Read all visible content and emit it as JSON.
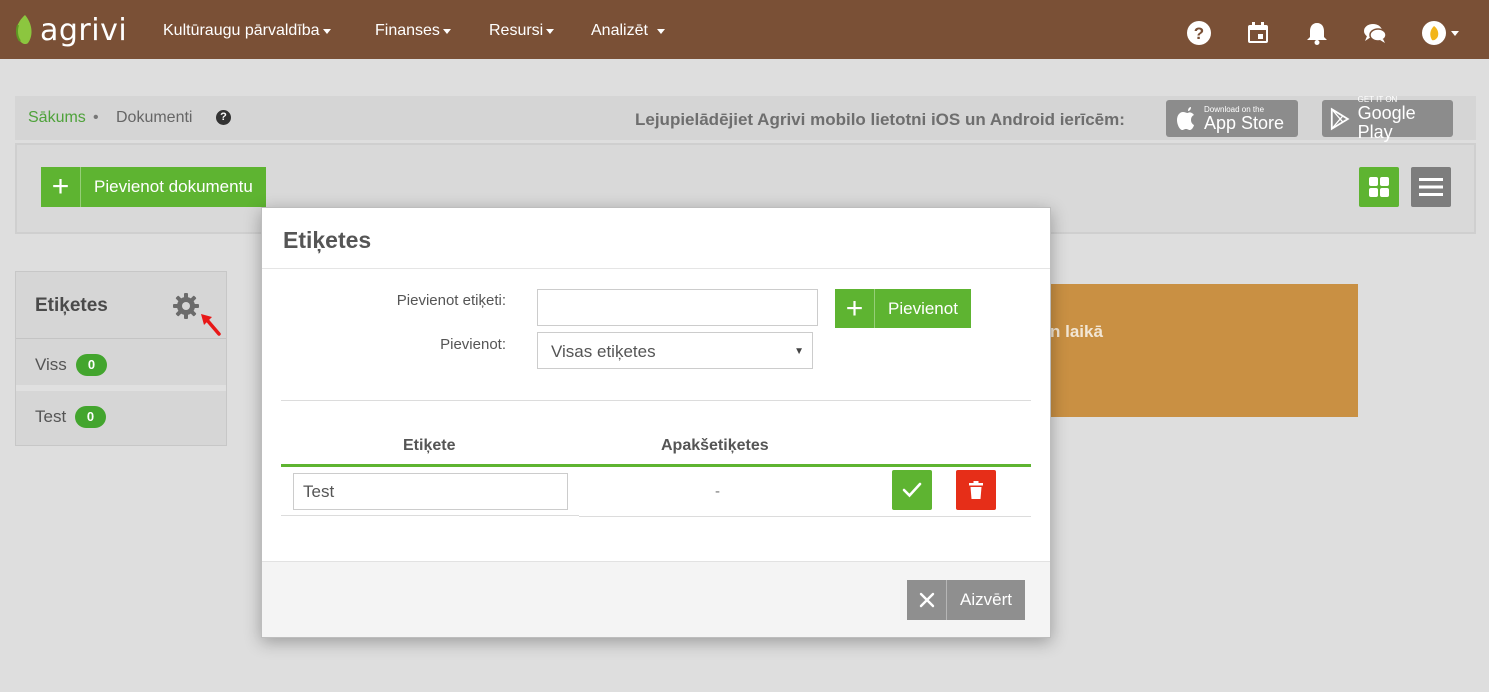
{
  "nav": {
    "logo_text": "agrivi",
    "menu": [
      {
        "label": "Kultūraugu pārvaldība"
      },
      {
        "label": "Finanses"
      },
      {
        "label": "Resursi"
      },
      {
        "label": "Analizēt"
      }
    ],
    "icons": [
      "help-icon",
      "calendar-icon",
      "bell-icon",
      "chat-icon",
      "user-avatar"
    ]
  },
  "breadcrumb": {
    "home": "Sākums",
    "separator": "•",
    "current": "Dokumenti",
    "help": "?"
  },
  "promo": {
    "text": "Lejupielādējiet Agrivi mobilo lietotni iOS un Android ierīcēm:",
    "app_store_small": "Download on the",
    "app_store_big": "App Store",
    "google_play_small": "GET IT ON",
    "google_play_big": "Google Play"
  },
  "toolbar": {
    "add_document_label": "Pievienot dokumentu",
    "plus": "+"
  },
  "sidebar": {
    "title": "Etiķetes",
    "items": [
      {
        "label": "Viss",
        "count": "0"
      },
      {
        "label": "Test",
        "count": "0"
      }
    ]
  },
  "alert": {
    "text_fragment": "n laikā"
  },
  "modal": {
    "title": "Etiķetes",
    "add_tag_label": "Pievienot etiķeti:",
    "add_tag_value": "",
    "add_to_label": "Pievienot:",
    "add_to_selected": "Visas etiķetes",
    "add_button_label": "Pievienot",
    "plus": "+",
    "table": {
      "headers": [
        "Etiķete",
        "Apakšetiķetes"
      ],
      "rows": [
        {
          "tag": "Test",
          "subtags": "-"
        }
      ]
    },
    "close_label": "Aizvērt"
  },
  "colors": {
    "nav_bg": "#7a5036",
    "primary_green": "#5eb431",
    "danger_red": "#e62e18",
    "alert_orange": "#c99043"
  }
}
